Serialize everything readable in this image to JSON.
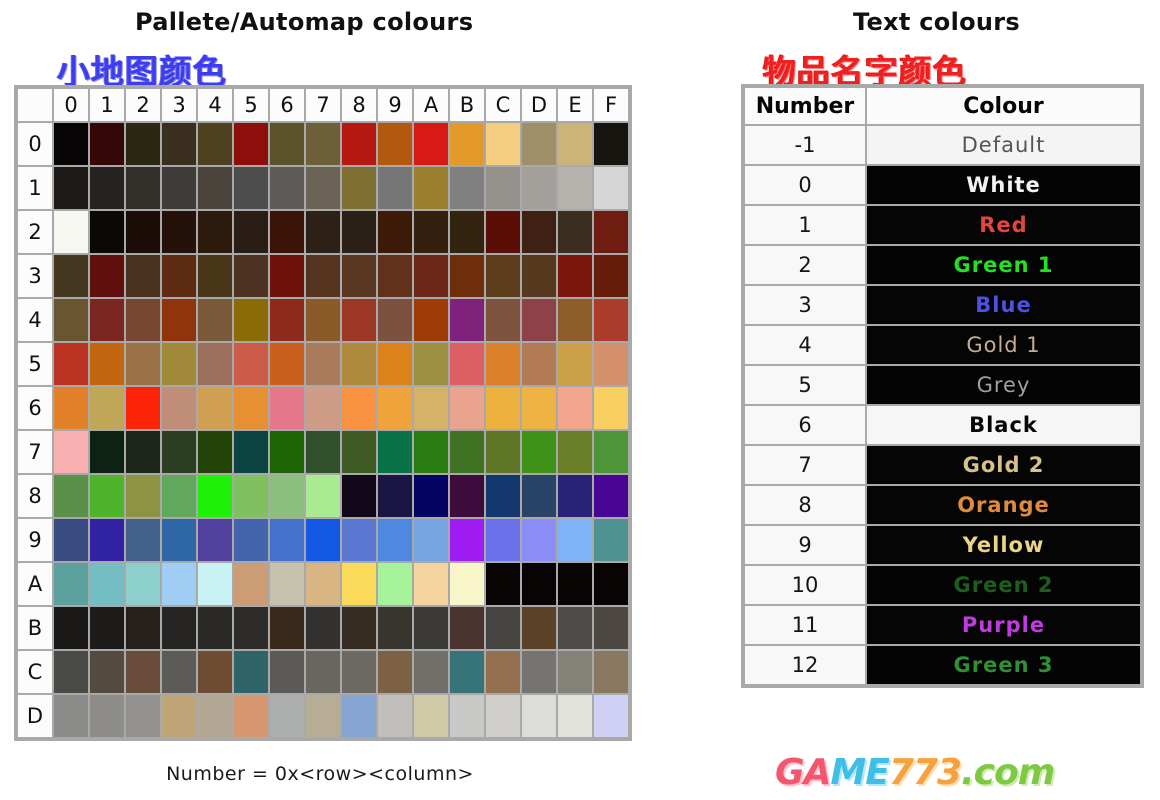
{
  "palette": {
    "title_en": "Pallete/Automap colours",
    "title_cn": "小地图颜色",
    "title_cn_color": "#3c3cf0",
    "footer_note": "Number = 0x<row><column>",
    "columns": [
      "0",
      "1",
      "2",
      "3",
      "4",
      "5",
      "6",
      "7",
      "8",
      "9",
      "A",
      "B",
      "C",
      "D",
      "E",
      "F"
    ],
    "rows": [
      {
        "label": "0",
        "colors": [
          "#060404",
          "#340806",
          "#2b2712",
          "#3a2f1e",
          "#4e411f",
          "#8c0f0b",
          "#5a5229",
          "#6d6038",
          "#b61812",
          "#b2580f",
          "#d81a16",
          "#e49a28",
          "#f5cd80",
          "#9e8f68",
          "#cbb379",
          "#181410"
        ]
      },
      {
        "label": "1",
        "colors": [
          "#1d1a18",
          "#262422",
          "#33302b",
          "#3e3b38",
          "#4b443c",
          "#4e4e4e",
          "#5d5c58",
          "#6b6355",
          "#7f6f33",
          "#767676",
          "#9b8030",
          "#808080",
          "#94908c",
          "#a3a09c",
          "#b6b3ae",
          "#d6d6d6"
        ]
      },
      {
        "label": "2",
        "colors": [
          "#f7f7f2",
          "#0c0806",
          "#1b0c07",
          "#24110a",
          "#2c1a0d",
          "#2a1d16",
          "#3c1407",
          "#2d2117",
          "#2a2017",
          "#3d1a07",
          "#35200f",
          "#32240f",
          "#5a0e06",
          "#3f2015",
          "#3b2d20",
          "#6e1d10"
        ]
      },
      {
        "label": "3",
        "colors": [
          "#453820",
          "#600f0d",
          "#49301f",
          "#5d2a12",
          "#4a3618",
          "#4e3322",
          "#6d120a",
          "#55341f",
          "#5a3723",
          "#63301c",
          "#6b2717",
          "#6e2d0b",
          "#5c3d1c",
          "#55381d",
          "#7a170c",
          "#651c09"
        ]
      },
      {
        "label": "4",
        "colors": [
          "#6a5531",
          "#7b2621",
          "#764633",
          "#90350b",
          "#78593a",
          "#8a6b05",
          "#8d2a1c",
          "#8a5b29",
          "#9d3827",
          "#7c5140",
          "#9f3c06",
          "#80217c",
          "#7d5340",
          "#8d4248",
          "#8e5c2b",
          "#ac3c2b"
        ]
      },
      {
        "label": "5",
        "colors": [
          "#bc3323",
          "#c2670f",
          "#9a7246",
          "#a08938",
          "#9c6f5c",
          "#cc5b49",
          "#cb5f1f",
          "#ab7c5c",
          "#b08b3e",
          "#db821a",
          "#9c8f42",
          "#dc5f64",
          "#da8028",
          "#b27a55",
          "#cc9f4b",
          "#d3906b"
        ]
      },
      {
        "label": "6",
        "colors": [
          "#e3812a",
          "#c0a757",
          "#fc2407",
          "#c08d78",
          "#d19f51",
          "#e78f33",
          "#e5788b",
          "#cf9d87",
          "#f99342",
          "#f0a33b",
          "#d5b267",
          "#eaa38c",
          "#efb13e",
          "#eeb342",
          "#f3a68d",
          "#f8ce60"
        ]
      },
      {
        "label": "7",
        "colors": [
          "#f8b0b1",
          "#0d2212",
          "#1d261b",
          "#2b3e21",
          "#234408",
          "#0c4442",
          "#1b6507",
          "#30502b",
          "#3d5b22",
          "#0a7248",
          "#2a7c10",
          "#3f7223",
          "#5f7528",
          "#3f9118",
          "#6b7e29",
          "#4e9439"
        ]
      },
      {
        "label": "8",
        "colors": [
          "#5b9048",
          "#4eb42c",
          "#8d9441",
          "#62a85c",
          "#1ef107",
          "#7fc05f",
          "#8cbe7e",
          "#a9eb91",
          "#12081a",
          "#1b1545",
          "#030560",
          "#3d0b3c",
          "#133870",
          "#2a4468",
          "#2a2277",
          "#490694"
        ]
      },
      {
        "label": "9",
        "colors": [
          "#384b81",
          "#3022a2",
          "#42628d",
          "#2f66a6",
          "#51419f",
          "#4465ad",
          "#4371cc",
          "#1459e3",
          "#5a77d1",
          "#4e88e1",
          "#74a5e0",
          "#9f1df3",
          "#6971e9",
          "#8b8cf5",
          "#80b2f7",
          "#4f9493"
        ]
      },
      {
        "label": "A",
        "colors": [
          "#5da19f",
          "#72bec2",
          "#8ccfcd",
          "#9fcdf3",
          "#c8f2f4",
          "#cc9d74",
          "#c7c2ae",
          "#dab584",
          "#fada58",
          "#a6f39c",
          "#f5d4a0",
          "#f8f6c8",
          "#070403",
          "#070403",
          "#070403",
          "#070403"
        ]
      },
      {
        "label": "B",
        "colors": [
          "#1a1917",
          "#1c1b19",
          "#25201c",
          "#262523",
          "#2b2926",
          "#2e2c2b",
          "#3a281a",
          "#333230",
          "#362b21",
          "#38352f",
          "#3b3a37",
          "#4a342f",
          "#454440",
          "#5c4229",
          "#4d4c49",
          "#4c4741"
        ]
      },
      {
        "label": "C",
        "colors": [
          "#4a4a47",
          "#554a3f",
          "#6a4c3a",
          "#5c5b58",
          "#6d4c33",
          "#2f6469",
          "#5b5a57",
          "#696660",
          "#6d6a64",
          "#7c6145",
          "#716f6a",
          "#36747a",
          "#937050",
          "#757470",
          "#848179",
          "#89785f"
        ]
      },
      {
        "label": "D",
        "colors": [
          "#8b8b89",
          "#8e8d8a",
          "#92918e",
          "#bfa477",
          "#b1a793",
          "#d59670",
          "#adafae",
          "#b7ac94",
          "#86a5d2",
          "#c0bfbb",
          "#d0c9a7",
          "#c8c8c6",
          "#cfcecb",
          "#dcdcda",
          "#e2e2dd",
          "#d0d0f4"
        ]
      }
    ]
  },
  "text_colours": {
    "title_en": "Text colours",
    "title_cn": "物品名字颜色",
    "title_cn_color": "#ef2020",
    "headers": [
      "Number",
      "Colour"
    ],
    "rows": [
      {
        "number": "-1",
        "label": "Default",
        "bg": "#f4f4f4",
        "fg": "#555555",
        "weight": "normal"
      },
      {
        "number": "0",
        "label": "White",
        "bg": "#040404",
        "fg": "#f2f2f2",
        "weight": "bold"
      },
      {
        "number": "1",
        "label": "Red",
        "bg": "#050505",
        "fg": "#e2463e",
        "weight": "bold"
      },
      {
        "number": "2",
        "label": "Green 1",
        "bg": "#040404",
        "fg": "#22e022",
        "weight": "bold"
      },
      {
        "number": "3",
        "label": "Blue",
        "bg": "#050505",
        "fg": "#4a52e2",
        "weight": "bold"
      },
      {
        "number": "4",
        "label": "Gold 1",
        "bg": "#050505",
        "fg": "#c7ae93",
        "weight": "normal"
      },
      {
        "number": "5",
        "label": "Grey",
        "bg": "#040404",
        "fg": "#a0a0a0",
        "weight": "normal"
      },
      {
        "number": "6",
        "label": "Black",
        "bg": "#f6f6f6",
        "fg": "#060606",
        "weight": "bold"
      },
      {
        "number": "7",
        "label": "Gold 2",
        "bg": "#050505",
        "fg": "#d7c18a",
        "weight": "bold"
      },
      {
        "number": "8",
        "label": "Orange",
        "bg": "#050505",
        "fg": "#e08a3c",
        "weight": "bold"
      },
      {
        "number": "9",
        "label": "Yellow",
        "bg": "#050505",
        "fg": "#e9d48a",
        "weight": "bold"
      },
      {
        "number": "10",
        "label": "Green 2",
        "bg": "#040404",
        "fg": "#1d5e1d",
        "weight": "bold"
      },
      {
        "number": "11",
        "label": "Purple",
        "bg": "#050505",
        "fg": "#c03ce0",
        "weight": "bold"
      },
      {
        "number": "12",
        "label": "Green 3",
        "bg": "#040404",
        "fg": "#2f8f33",
        "weight": "bold"
      }
    ]
  },
  "watermark": {
    "parts": [
      {
        "text": "GA",
        "color": "#f4566f"
      },
      {
        "text": "ME",
        "color": "#3fbfe8"
      },
      {
        "text": "773",
        "color": "#f7a13c"
      },
      {
        "text": ".com",
        "color": "#7dc943"
      }
    ]
  }
}
